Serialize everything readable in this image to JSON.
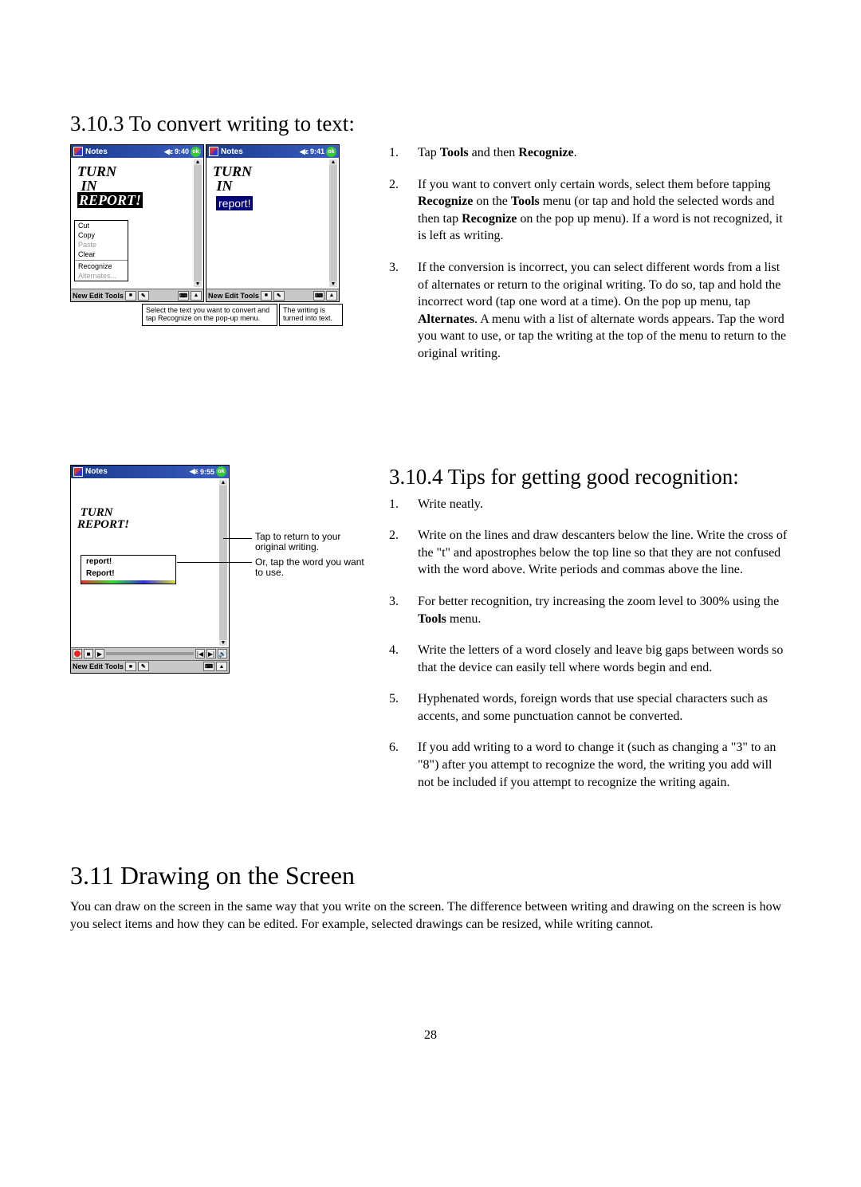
{
  "section_3_10_3": {
    "title": "3.10.3  To convert writing to text:",
    "steps": [
      {
        "num": "1.",
        "txt": "Tap <b>Tools</b> and then <b>Recognize</b>."
      },
      {
        "num": "2.",
        "txt": "If you want to convert only certain words, select them before tapping <b>Recognize</b> on the <b>Tools</b> menu (or tap and hold the selected words and then tap <b>Recognize</b> on the pop up menu). If a word is not recognized, it is left as writing."
      },
      {
        "num": "3.",
        "txt": "If the conversion is incorrect, you can select different words from a list of alternates or return to the original writing. To do so, tap and hold the incorrect word (tap one word at a time). On the pop up menu, tap <b>Alternates</b>. A menu with a list of alternate words appears. Tap the word you want to use, or tap the writing at the top of the menu to return to the original writing."
      }
    ],
    "screenshot_left": {
      "app_title": "Notes",
      "time": "9:40",
      "handwriting_lines": [
        "TURN",
        " IN",
        "REPORT!"
      ],
      "popup_items": [
        {
          "label": "Cut",
          "disabled": false
        },
        {
          "label": "Copy",
          "disabled": false
        },
        {
          "label": "Paste",
          "disabled": true
        },
        {
          "label": "Clear",
          "disabled": false
        },
        {
          "label": "Recognize",
          "disabled": false
        },
        {
          "label": "Alternates...",
          "disabled": true
        }
      ],
      "bottom_bar": "New Edit Tools"
    },
    "screenshot_right": {
      "app_title": "Notes",
      "time": "9:41",
      "handwriting_lines": [
        "TURN",
        " IN"
      ],
      "converted_text": "report!",
      "bottom_bar": "New Edit Tools"
    },
    "caption_left": "Select the text you want to convert and tap Recognize on the pop-up menu.",
    "caption_right": "The writing is turned into text."
  },
  "section_3_10_4": {
    "title": "3.10.4  Tips for getting good recognition:",
    "steps": [
      {
        "num": "1.",
        "txt": "Write neatly."
      },
      {
        "num": "2.",
        "txt": "Write on the lines and draw descanters below the line. Write the cross of the \"t\" and apostrophes below the top line so that they are not confused with the word above. Write periods and commas above the line."
      },
      {
        "num": "3.",
        "txt": "For better recognition, try increasing the zoom level to 300% using the <b>Tools</b> menu."
      },
      {
        "num": "4.",
        "txt": "Write the letters of a word closely and leave big gaps between words so that the device can easily tell where words begin and end."
      },
      {
        "num": "5.",
        "txt": "Hyphenated words, foreign words that use special characters such as accents, and some punctuation cannot be converted."
      },
      {
        "num": "6.",
        "txt": "If you add writing to a word to change it (such as changing a \"3\" to an \"8\") after you attempt to recognize the word, the writing you add will not be included if you attempt to recognize the writing again."
      }
    ],
    "screenshot": {
      "app_title": "Notes",
      "time": "9:55",
      "handwriting_lines": [
        "TURN",
        "REPORT!"
      ],
      "alt_items": [
        "report!",
        "Report!"
      ],
      "bottom_bar": "New Edit Tools"
    },
    "ann1": "Tap to return to your original writing.",
    "ann2": "Or, tap the word you want to use."
  },
  "section_3_11": {
    "title": "3.11 Drawing on the Screen",
    "body": "You can draw on the screen in the same way that you write on the screen. The difference between writing and drawing on the screen is how you select items and how they can be edited. For example, selected drawings can be resized, while writing cannot."
  },
  "page_number": "28"
}
